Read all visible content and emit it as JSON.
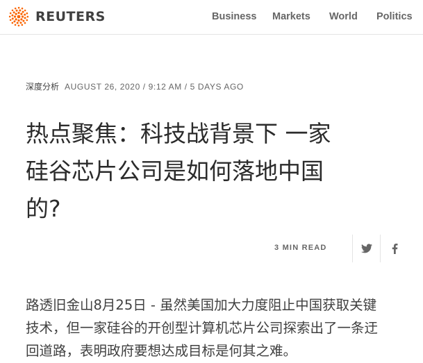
{
  "brand": {
    "name": "REUTERS",
    "accent": "#fa6400"
  },
  "nav": {
    "items": [
      "Business",
      "Markets",
      "World",
      "Politics"
    ]
  },
  "article": {
    "category": "深度分析",
    "dateline": "AUGUST 26, 2020 / 9:12 AM / 5 DAYS AGO",
    "title_lines": [
      "热点聚焦：科技战背景下 一家",
      "硅谷芯片公司是如何落地中国",
      "的?"
    ],
    "read_time": "3 MIN READ",
    "share": {
      "twitter_icon": "twitter-icon",
      "facebook_icon": "facebook-icon"
    },
    "lede_lines": [
      "路透旧金山8月25日 - 虽然美国加大力度阻止中国获取关键",
      "技术，但一家硅谷的开创型计算机芯片公司探索出了一条迂",
      "回道路，表明政府要想达成目标是何其之难。"
    ]
  }
}
